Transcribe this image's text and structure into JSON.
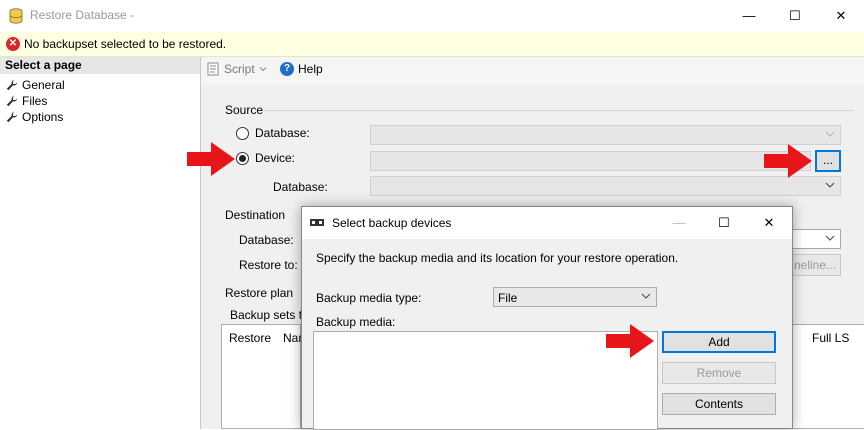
{
  "window": {
    "title": "Restore Database -",
    "caption_buttons": {
      "minimize": "—",
      "maximize": "☐",
      "close": "✕"
    }
  },
  "infobar": {
    "message": "No backupset selected to be restored."
  },
  "left_pane": {
    "header": "Select a page",
    "items": [
      {
        "label": "General",
        "icon": "wrench-icon"
      },
      {
        "label": "Files",
        "icon": "wrench-icon"
      },
      {
        "label": "Options",
        "icon": "wrench-icon"
      }
    ]
  },
  "toolbar": {
    "script_label": "Script",
    "help_label": "Help"
  },
  "source": {
    "section_label": "Source",
    "database_radio_label": "Database:",
    "device_radio_label": "Device:",
    "device_value": "",
    "browse_label": "...",
    "device_database_label": "Database:",
    "selected": "device"
  },
  "destination": {
    "section_label": "Destination",
    "database_label": "Database:",
    "restore_to_label": "Restore to:",
    "timeline_button_label": "neline..."
  },
  "restore_plan": {
    "section_label": "Restore plan",
    "backup_sets_label": "Backup sets to",
    "columns_left": [
      "Restore",
      "Nam"
    ],
    "columns_right": [
      "Full LS"
    ]
  },
  "dialog": {
    "title": "Select backup devices",
    "description": "Specify the backup media and its location for your restore operation.",
    "media_type_label": "Backup media type:",
    "media_type_value": "File",
    "media_label": "Backup media:",
    "buttons": {
      "add": "Add",
      "remove": "Remove",
      "contents": "Contents"
    },
    "caption_buttons": {
      "minimize": "—",
      "maximize": "☐",
      "close": "✕"
    }
  },
  "colors": {
    "arrow": "#e8161b",
    "infobar_bg": "#ffffe1",
    "error_icon": "#d8262c",
    "help_icon": "#1e6fc5",
    "focus_border": "#0078d7"
  }
}
